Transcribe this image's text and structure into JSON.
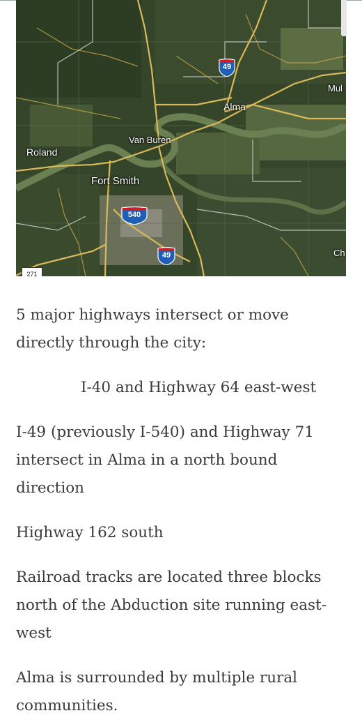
{
  "map": {
    "labels": {
      "roland": "Roland",
      "van_buren": "Van Buren",
      "fort_smith": "Fort Smith",
      "alma": "Alma",
      "mul": "Mul",
      "ch": "Ch"
    },
    "shields": {
      "i49_north": "49",
      "i540": "540",
      "i49_south": "49",
      "us271": "271"
    }
  },
  "article": {
    "intro": "5 major highways intersect or move directly through the city:",
    "i40": "I-40 and Highway 64 east-west",
    "i49": "I-49 (previously I-540) and Highway 71 intersect in Alma in a north bound direction",
    "hwy162": "Highway 162 south",
    "railroad": "Railroad tracks are located three blocks north of the Abduction site running east-west",
    "rural": "Alma is surrounded by multiple rural communities."
  },
  "colors": {
    "text": "#3a3a3a",
    "map_base": "#2f3f22",
    "road": "#d9b95a",
    "river": "#6a7f52",
    "interstate_blue": "#1f5fb8",
    "interstate_red": "#c8202b"
  }
}
